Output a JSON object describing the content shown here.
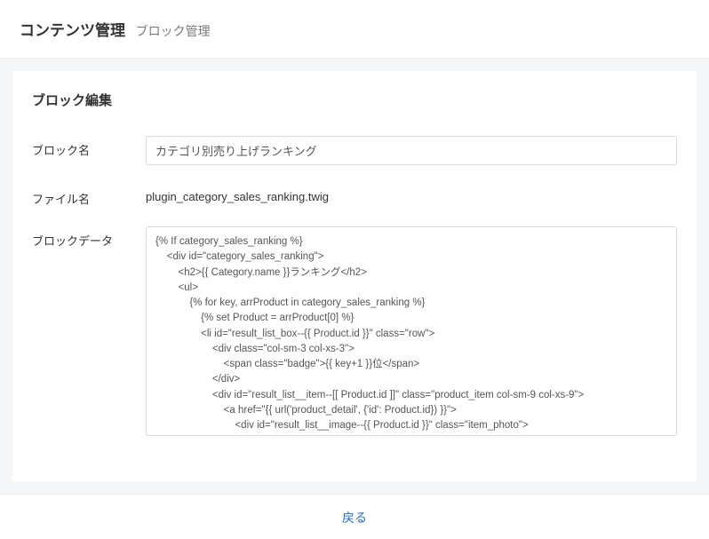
{
  "header": {
    "title": "コンテンツ管理",
    "subtitle": "ブロック管理"
  },
  "panel": {
    "title": "ブロック編集"
  },
  "form": {
    "block_name": {
      "label": "ブロック名",
      "value": "カテゴリ別売り上げランキング"
    },
    "file_name": {
      "label": "ファイル名",
      "value": "plugin_category_sales_ranking.twig"
    },
    "block_data": {
      "label": "ブロックデータ",
      "value": "{% If category_sales_ranking %}\n    <div id=\"category_sales_ranking\">\n        <h2>{{ Category.name }}ランキング</h2>\n        <ul>\n            {% for key, arrProduct in category_sales_ranking %}\n                {% set Product = arrProduct[0] %}\n                <li id=\"result_list_box--{{ Product.id }}\" class=\"row\">\n                    <div class=\"col-sm-3 col-xs-3\">\n                        <span class=\"badge\">{{ key+1 }}位</span>\n                    </div>\n                    <div id=\"result_list__item--[[ Product.id ]]\" class=\"product_item col-sm-9 col-xs-9\">\n                        <a href=\"{{ url('product_detail', {'id': Product.id}) }}\">\n                            <div id=\"result_list__image--{{ Product.id }}\" class=\"item_photo\">\n                                <img src=\"{{ app.config.image_save_urlpath }}/{{ Product.main_list_image|no_image_product }}\">\n                            </div>\n"
    }
  },
  "footer": {
    "back_label": "戻る"
  }
}
